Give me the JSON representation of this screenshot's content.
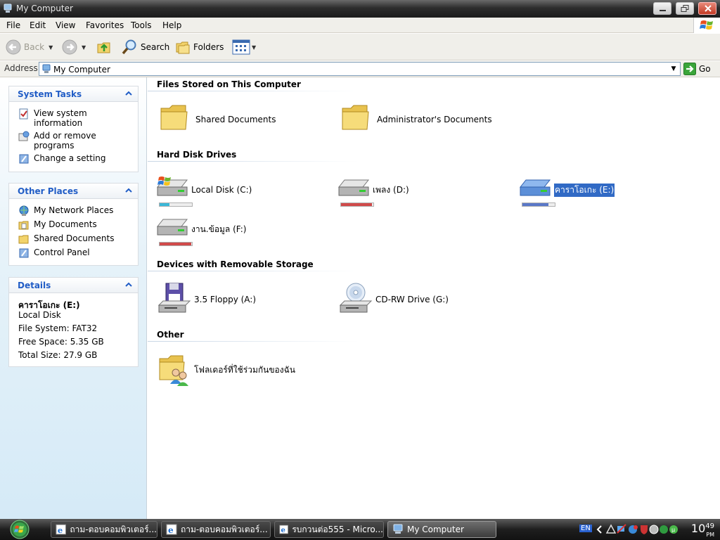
{
  "window": {
    "title": "My Computer"
  },
  "menu": [
    "File",
    "Edit",
    "View",
    "Favorites",
    "Tools",
    "Help"
  ],
  "toolbar": {
    "back": "Back",
    "search": "Search",
    "folders": "Folders"
  },
  "address": {
    "label": "Address",
    "value": "My Computer",
    "go": "Go"
  },
  "system_tasks": {
    "title": "System Tasks",
    "items": [
      "View system information",
      "Add or remove programs",
      "Change a setting"
    ]
  },
  "other_places": {
    "title": "Other Places",
    "items": [
      "My Network Places",
      "My Documents",
      "Shared Documents",
      "Control Panel"
    ]
  },
  "details": {
    "title": "Details",
    "name": "คาราโอเกะ (E:)",
    "type": "Local Disk",
    "file_system": "File System: FAT32",
    "free_space": "Free Space: 5.35 GB",
    "total_size": "Total Size: 27.9 GB"
  },
  "sections": {
    "files_stored": {
      "title": "Files Stored on This Computer",
      "items": [
        "Shared Documents",
        "Administrator's Documents"
      ]
    },
    "hard_disks": {
      "title": "Hard Disk Drives",
      "items": [
        {
          "label": "Local Disk (C:)",
          "used_fraction": 0.3,
          "color": "#3bb8d8"
        },
        {
          "label": "เพลง (D:)",
          "used_fraction": 0.95,
          "color": "#d04a4a"
        },
        {
          "label": "คาราโอเกะ (E:)",
          "used_fraction": 0.8,
          "color": "#5a78c8"
        },
        {
          "label": "งาน.ข้อมูล (F:)",
          "used_fraction": 0.97,
          "color": "#d04a4a"
        }
      ]
    },
    "removable": {
      "title": "Devices with Removable Storage",
      "items": [
        "3.5 Floppy (A:)",
        "CD-RW Drive (G:)"
      ]
    },
    "other": {
      "title": "Other",
      "items": [
        "โฟลเดอร์ที่ใช้ร่วมกันของฉัน"
      ]
    }
  },
  "taskbar": {
    "tasks": [
      "ถาม-ตอบคอมพิวเตอร์...",
      "ถาม-ตอบคอมพิวเตอร์...",
      "รบกวนต่อ555 - Micro...",
      "My Computer"
    ],
    "lang": "EN",
    "clock": "10",
    "clock_minutes": "49",
    "clock_ampm": "PM"
  }
}
